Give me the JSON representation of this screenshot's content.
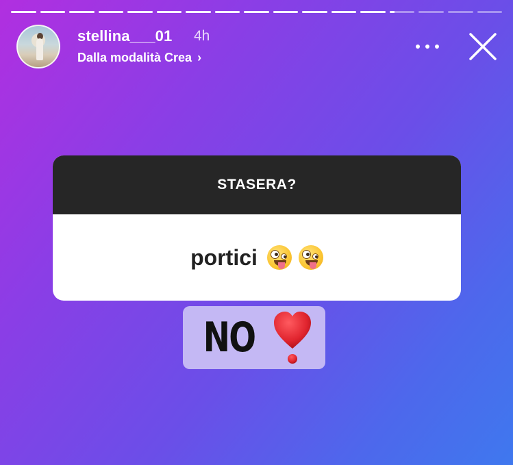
{
  "story": {
    "segments_total": 17,
    "segments_completed": 13,
    "current_segment_progress": 0.2
  },
  "header": {
    "username": "stellina___01",
    "time_ago": "4h",
    "subtitle": "Dalla modalità Crea",
    "subtitle_chevron": "›"
  },
  "question_sticker": {
    "question": "STASERA?",
    "answer": "portici",
    "answer_emojis": [
      "zany-face",
      "zany-face"
    ]
  },
  "reply_sticker": {
    "text": "NO",
    "emoji": "heavy-exclamation-heart"
  },
  "colors": {
    "gradient_start": "#b12fe0",
    "gradient_end": "#3f78ee",
    "question_header_bg": "#262626",
    "reply_bg": "#c4b8f4",
    "heart_red": "#e0242e"
  }
}
